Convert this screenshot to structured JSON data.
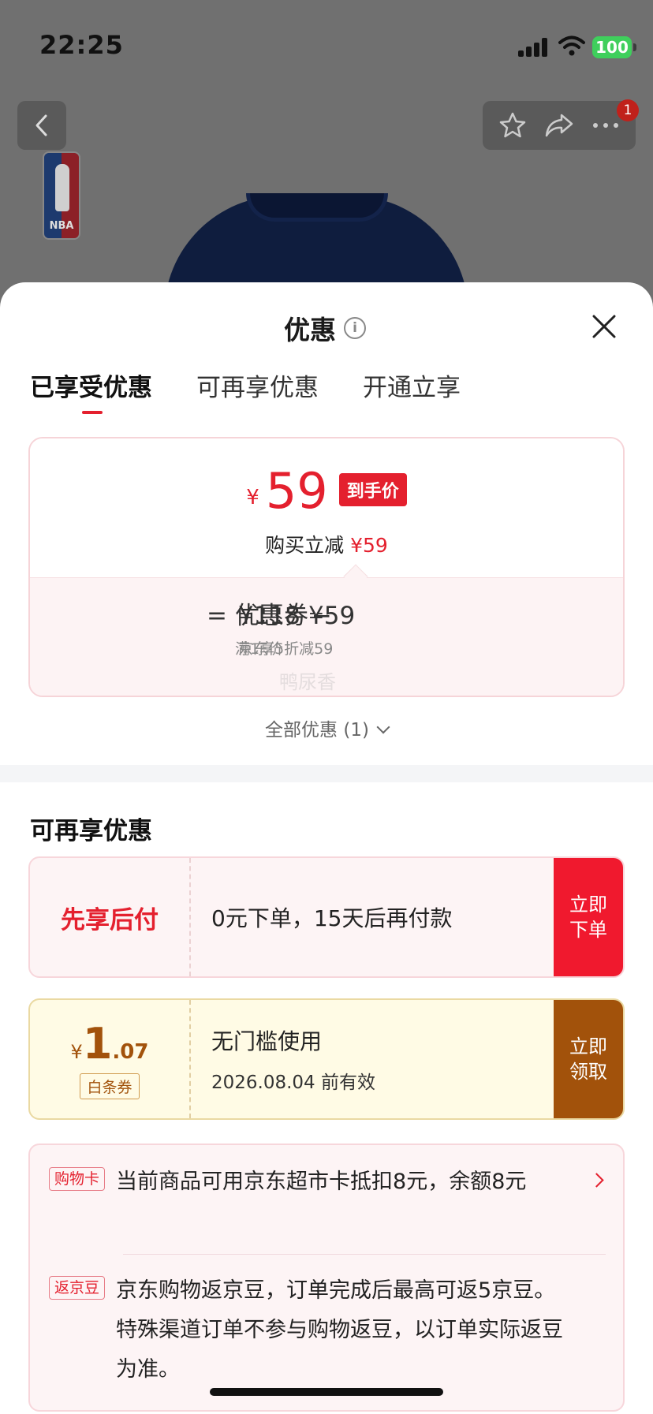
{
  "status_bar": {
    "time": "22:25",
    "battery": "100"
  },
  "product_nav": {
    "badge_count": "1",
    "logo_text": "NBA"
  },
  "sheet": {
    "title": "优惠",
    "tabs": [
      {
        "label": "已享受优惠",
        "active": true
      },
      {
        "label": "可再享优惠",
        "active": false
      },
      {
        "label": "开通立享",
        "active": false
      }
    ]
  },
  "price_card": {
    "currency": "¥",
    "price": "59",
    "price_tag": "到手价",
    "reduce_label": "购买立减",
    "reduce_value": "¥59",
    "equals": "=",
    "minus": "−",
    "base_price": "¥118",
    "base_caption": "京东价",
    "coupon_value": "优惠券¥59",
    "coupon_caption": "满1享5折减59",
    "watermark": "鸭尿香"
  },
  "all_discounts": "全部优惠 (1)",
  "section_title": "可再享优惠",
  "offers": {
    "pay_later": {
      "label": "先享后付",
      "desc": "0元下单，15天后再付款",
      "action": "立即下单"
    },
    "baitiao": {
      "currency": "¥",
      "amount_int": "1",
      "amount_dec": ".07",
      "tag": "白条券",
      "desc": "无门槛使用",
      "valid": "2026.08.04 前有效",
      "action": "立即领取"
    }
  },
  "info": {
    "shopping_card": {
      "tag": "购物卡",
      "text": "当前商品可用京东超市卡抵扣8元，余额8元"
    },
    "jd_beans": {
      "tag": "返京豆",
      "text": "京东购物返京豆，订单完成后最高可返5京豆。特殊渠道订单不参与购物返豆，以订单实际返豆为准。"
    }
  },
  "colors": {
    "accent_red": "#e4202e",
    "action_red": "#f0192e",
    "baitiao_brown": "#a2520b",
    "battery_green": "#3fcf5c"
  }
}
